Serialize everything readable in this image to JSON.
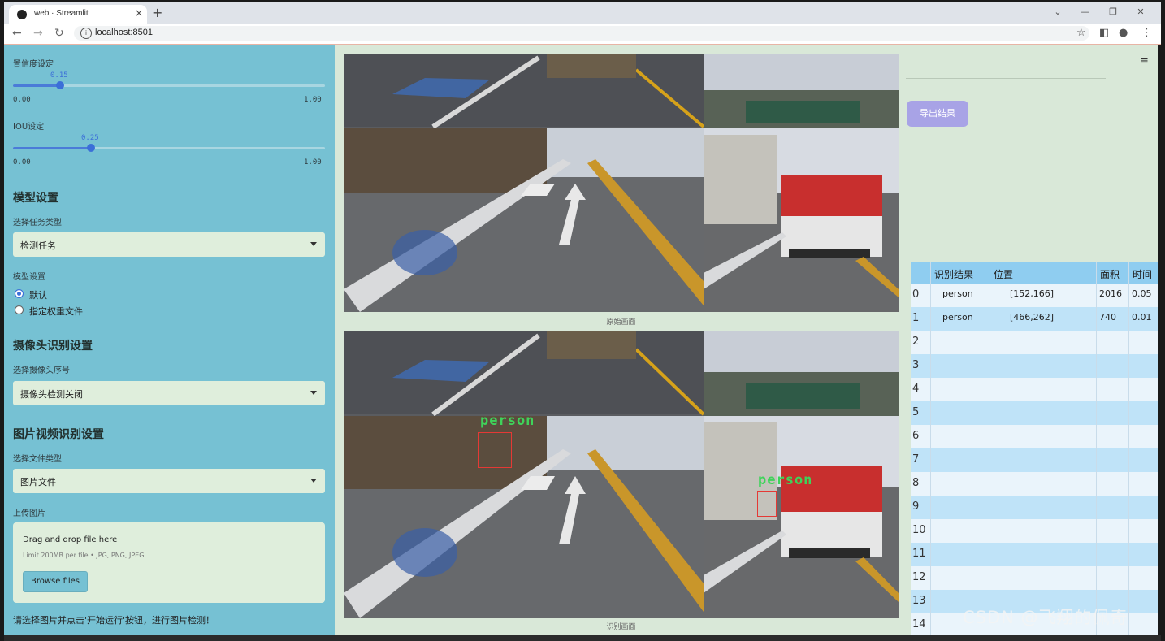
{
  "browser": {
    "tab_title": "web · Streamlit",
    "url": "localhost:8501",
    "tab_close": "×",
    "new_tab": "+",
    "minimize": "⌄",
    "min": "—",
    "restore": "❐",
    "close": "✕"
  },
  "sidebar": {
    "confidence_label": "置信度设定",
    "confidence": {
      "value": "0.15",
      "min": "0.00",
      "max": "1.00",
      "fraction": 0.15
    },
    "iou_label": "IOU设定",
    "iou": {
      "value": "0.25",
      "min": "0.00",
      "max": "1.00",
      "fraction": 0.25
    },
    "model_heading": "模型设置",
    "task_label": "选择任务类型",
    "task_value": "检测任务",
    "model_label": "模型设置",
    "model_options": [
      "默认",
      "指定权重文件"
    ],
    "model_selected": "默认",
    "camera_heading": "摄像头识别设置",
    "camera_label": "选择摄像头序号",
    "camera_value": "摄像头检测关闭",
    "media_heading": "图片视频识别设置",
    "filetype_label": "选择文件类型",
    "filetype_value": "图片文件",
    "upload_label": "上传图片",
    "upload_title": "Drag and drop file here",
    "upload_limit": "Limit 200MB per file • JPG, PNG, JPEG",
    "browse_label": "Browse files",
    "note": "请选择图片并点击'开始运行'按钮，进行图片检测！"
  },
  "main": {
    "original_caption": "原始画面",
    "detected_caption": "识别画面",
    "detections": [
      {
        "label": "person"
      },
      {
        "label": "person"
      }
    ]
  },
  "right": {
    "export_label": "导出结果",
    "table": {
      "columns": [
        "",
        "识别结果",
        "位置",
        "面积",
        "时间"
      ],
      "rows": [
        {
          "idx": "0",
          "result": "person",
          "pos": "[152,166]",
          "area": "2016",
          "time": "0.05"
        },
        {
          "idx": "1",
          "result": "person",
          "pos": "[466,262]",
          "area": "740",
          "time": "0.01"
        },
        {
          "idx": "2",
          "result": "",
          "pos": "",
          "area": "",
          "time": ""
        },
        {
          "idx": "3",
          "result": "",
          "pos": "",
          "area": "",
          "time": ""
        },
        {
          "idx": "4",
          "result": "",
          "pos": "",
          "area": "",
          "time": ""
        },
        {
          "idx": "5",
          "result": "",
          "pos": "",
          "area": "",
          "time": ""
        },
        {
          "idx": "6",
          "result": "",
          "pos": "",
          "area": "",
          "time": ""
        },
        {
          "idx": "7",
          "result": "",
          "pos": "",
          "area": "",
          "time": ""
        },
        {
          "idx": "8",
          "result": "",
          "pos": "",
          "area": "",
          "time": ""
        },
        {
          "idx": "9",
          "result": "",
          "pos": "",
          "area": "",
          "time": ""
        },
        {
          "idx": "10",
          "result": "",
          "pos": "",
          "area": "",
          "time": ""
        },
        {
          "idx": "11",
          "result": "",
          "pos": "",
          "area": "",
          "time": ""
        },
        {
          "idx": "12",
          "result": "",
          "pos": "",
          "area": "",
          "time": ""
        },
        {
          "idx": "13",
          "result": "",
          "pos": "",
          "area": "",
          "time": ""
        },
        {
          "idx": "14",
          "result": "",
          "pos": "",
          "area": "",
          "time": ""
        }
      ]
    },
    "watermark": "CSDN @飞翔的佩奇"
  },
  "colors": {
    "sidebar_bg": "#76c1d3",
    "page_bg": "#d9e8d8",
    "accent_blue": "#3b6fd8",
    "export_btn": "#a8a3e6",
    "table_header": "#8fcdf0",
    "det_box": "#e53935",
    "det_label": "#3fd35a"
  }
}
